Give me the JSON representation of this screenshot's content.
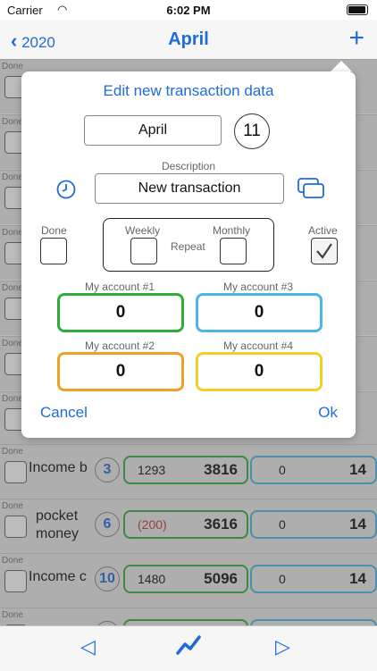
{
  "status": {
    "carrier": "Carrier",
    "time": "6:02 PM"
  },
  "nav": {
    "back_label": "2020",
    "title": "April",
    "add_label": "+"
  },
  "rows": [
    {
      "done": "Done",
      "label": "Income b",
      "num": "3",
      "g_left": "1293",
      "g_right": "3816",
      "b_left": "0",
      "b_right": "14"
    },
    {
      "done": "Done",
      "label": "pocket money",
      "num": "6",
      "g_left": "(200)",
      "g_right": "3616",
      "b_left": "0",
      "b_right": "14"
    },
    {
      "done": "Done",
      "label": "Income c",
      "num": "10",
      "g_left": "1480",
      "g_right": "5096",
      "b_left": "0",
      "b_right": "14"
    },
    {
      "done": "Done"
    }
  ],
  "bg_done_labels": [
    "Done",
    "Done",
    "Done",
    "Done",
    "Done",
    "Done",
    "Done"
  ],
  "dialog": {
    "title": "Edit new transaction data",
    "month": "April",
    "day": "11",
    "description_label": "Description",
    "description_value": "New transaction",
    "done_label": "Done",
    "weekly_label": "Weekly",
    "repeat_label": "Repeat",
    "monthly_label": "Monthly",
    "active_label": "Active",
    "accounts": [
      {
        "label": "My account #1",
        "value": "0",
        "color": "#2fad3c"
      },
      {
        "label": "My account #3",
        "value": "0",
        "color": "#4ab7e6"
      },
      {
        "label": "My account #2",
        "value": "0",
        "color": "#f0a027"
      },
      {
        "label": "My account #4",
        "value": "0",
        "color": "#f2d02b"
      }
    ],
    "cancel_label": "Cancel",
    "ok_label": "Ok"
  },
  "colors": {
    "accent": "#1f6cd8"
  }
}
